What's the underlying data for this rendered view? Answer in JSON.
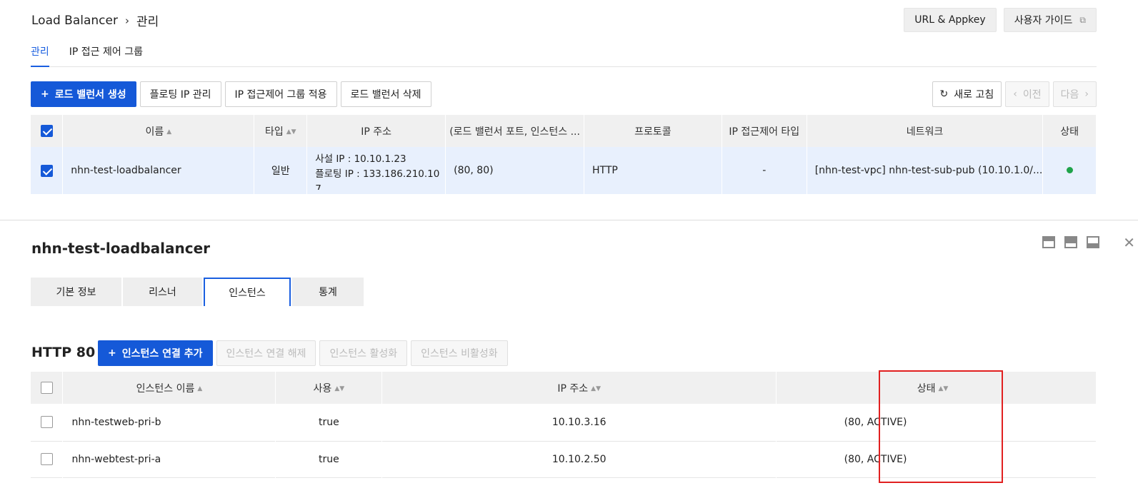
{
  "breadcrumb": {
    "root": "Load Balancer",
    "separator": "›",
    "current": "관리"
  },
  "top_buttons": {
    "url_appkey": "URL & Appkey",
    "user_guide": "사용자 가이드"
  },
  "top_tabs": [
    {
      "label": "관리",
      "active": true
    },
    {
      "label": "IP 접근 제어 그룹",
      "active": false
    }
  ],
  "toolbar": {
    "create": "로드 밸런서 생성",
    "floating_ip": "플로팅 IP 관리",
    "apply_acl": "IP 접근제어 그룹 적용",
    "delete": "로드 밸런서 삭제",
    "refresh": "새로 고침",
    "prev": "이전",
    "next": "다음"
  },
  "lb_table": {
    "headers": [
      "이름",
      "타입",
      "IP 주소",
      "(로드 밸런서 포트, 인스턴스 ...",
      "프로토콜",
      "IP 접근제어 타입",
      "네트워크",
      "상태"
    ],
    "rows": [
      {
        "selected": true,
        "name": "nhn-test-loadbalancer",
        "type": "일반",
        "ip_private": "사설 IP : 10.10.1.23",
        "ip_floating_1": "플로팅 IP : 133.186.210.10",
        "ip_floating_2": "7",
        "ports": "(80, 80)",
        "protocol": "HTTP",
        "acl_type": "-",
        "network": "[nhn-test-vpc] nhn-test-sub-pub (10.10.1.0/...",
        "status_color": "#1fa34a"
      }
    ]
  },
  "detail": {
    "title": "nhn-test-loadbalancer",
    "tabs": [
      {
        "label": "기본 정보",
        "active": false
      },
      {
        "label": "리스너",
        "active": false
      },
      {
        "label": "인스턴스",
        "active": true
      },
      {
        "label": "통계",
        "active": false
      }
    ],
    "section_title": "HTTP 80",
    "toolbar": {
      "add": "인스턴스 연결 추가",
      "detach": "인스턴스 연결 해제",
      "activate": "인스턴스 활성화",
      "deactivate": "인스턴스 비활성화"
    },
    "instance_table": {
      "headers": [
        "인스턴스 이름",
        "사용",
        "IP 주소",
        "상태"
      ],
      "rows": [
        {
          "name": "nhn-testweb-pri-b",
          "use": "true",
          "ip": "10.10.3.16",
          "status": "(80, ACTIVE)"
        },
        {
          "name": "nhn-webtest-pri-a",
          "use": "true",
          "ip": "10.10.2.50",
          "status": "(80, ACTIVE)"
        }
      ]
    }
  },
  "icons": {
    "plus": "+",
    "refresh": "↻",
    "chev_left": "‹",
    "chev_right": "›",
    "external": "⧉",
    "close": "✕",
    "sort": "▲▼"
  },
  "colors": {
    "primary": "#1559d8",
    "selected_row": "#e8f0fd",
    "highlight_box": "#e12020",
    "status_active": "#1fa34a"
  }
}
